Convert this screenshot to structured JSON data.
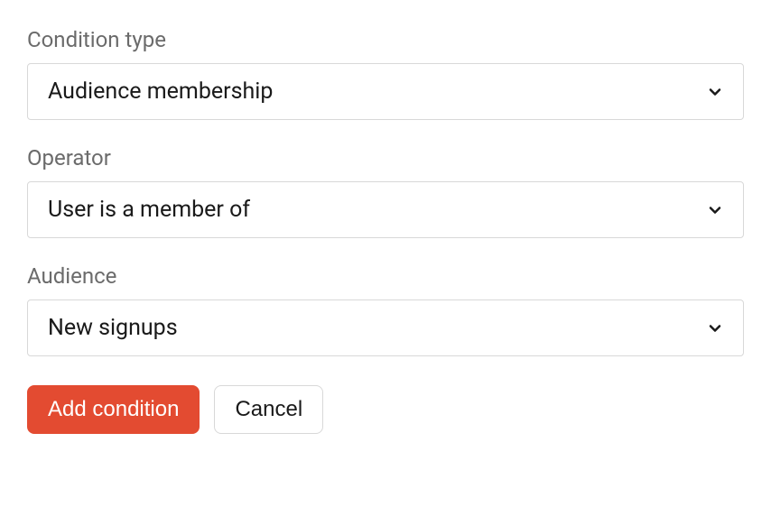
{
  "fields": {
    "condition_type": {
      "label": "Condition type",
      "value": "Audience membership"
    },
    "operator": {
      "label": "Operator",
      "value": "User is a member of"
    },
    "audience": {
      "label": "Audience",
      "value": "New signups"
    }
  },
  "buttons": {
    "primary": "Add condition",
    "secondary": "Cancel"
  }
}
